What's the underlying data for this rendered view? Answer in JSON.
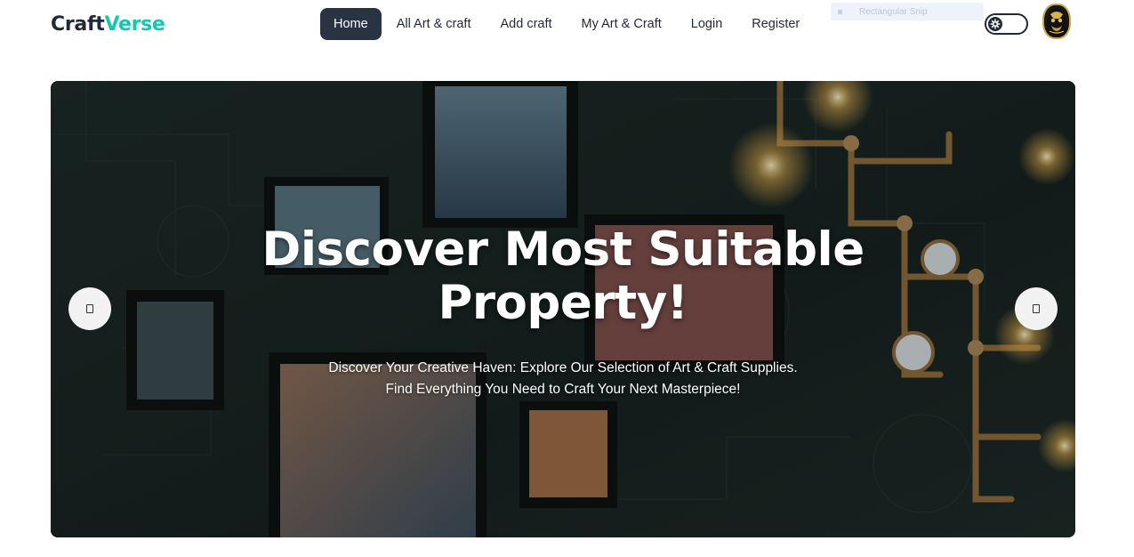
{
  "brand": {
    "part1": "Craft",
    "part2": "Verse"
  },
  "nav": {
    "items": [
      {
        "label": "Home",
        "active": true
      },
      {
        "label": "All Art & craft",
        "active": false
      },
      {
        "label": "Add craft",
        "active": false
      },
      {
        "label": "My Art & Craft",
        "active": false
      },
      {
        "label": "Login",
        "active": false
      },
      {
        "label": "Register",
        "active": false
      }
    ]
  },
  "overlay_chip": {
    "label": "Rectangular Snip"
  },
  "theme_toggle": {
    "icon": "gear-icon"
  },
  "avatar": {
    "icon": "user-avatar"
  },
  "hero": {
    "title_line1": "Discover Most Suitable",
    "title_line2": "Property!",
    "subtitle_line1": "Discover Your Creative Haven: Explore Our Selection of Art & Craft Supplies.",
    "subtitle_line2": "Find Everything You Need to Craft Your Next Masterpiece!",
    "prev_icon": "prev-arrow-icon",
    "next_icon": "next-arrow-icon"
  },
  "colors": {
    "brand_dark": "#1f2937",
    "brand_accent": "#14c8b0",
    "nav_active_bg": "#2a3342",
    "hero_bg": "#1b2624"
  }
}
